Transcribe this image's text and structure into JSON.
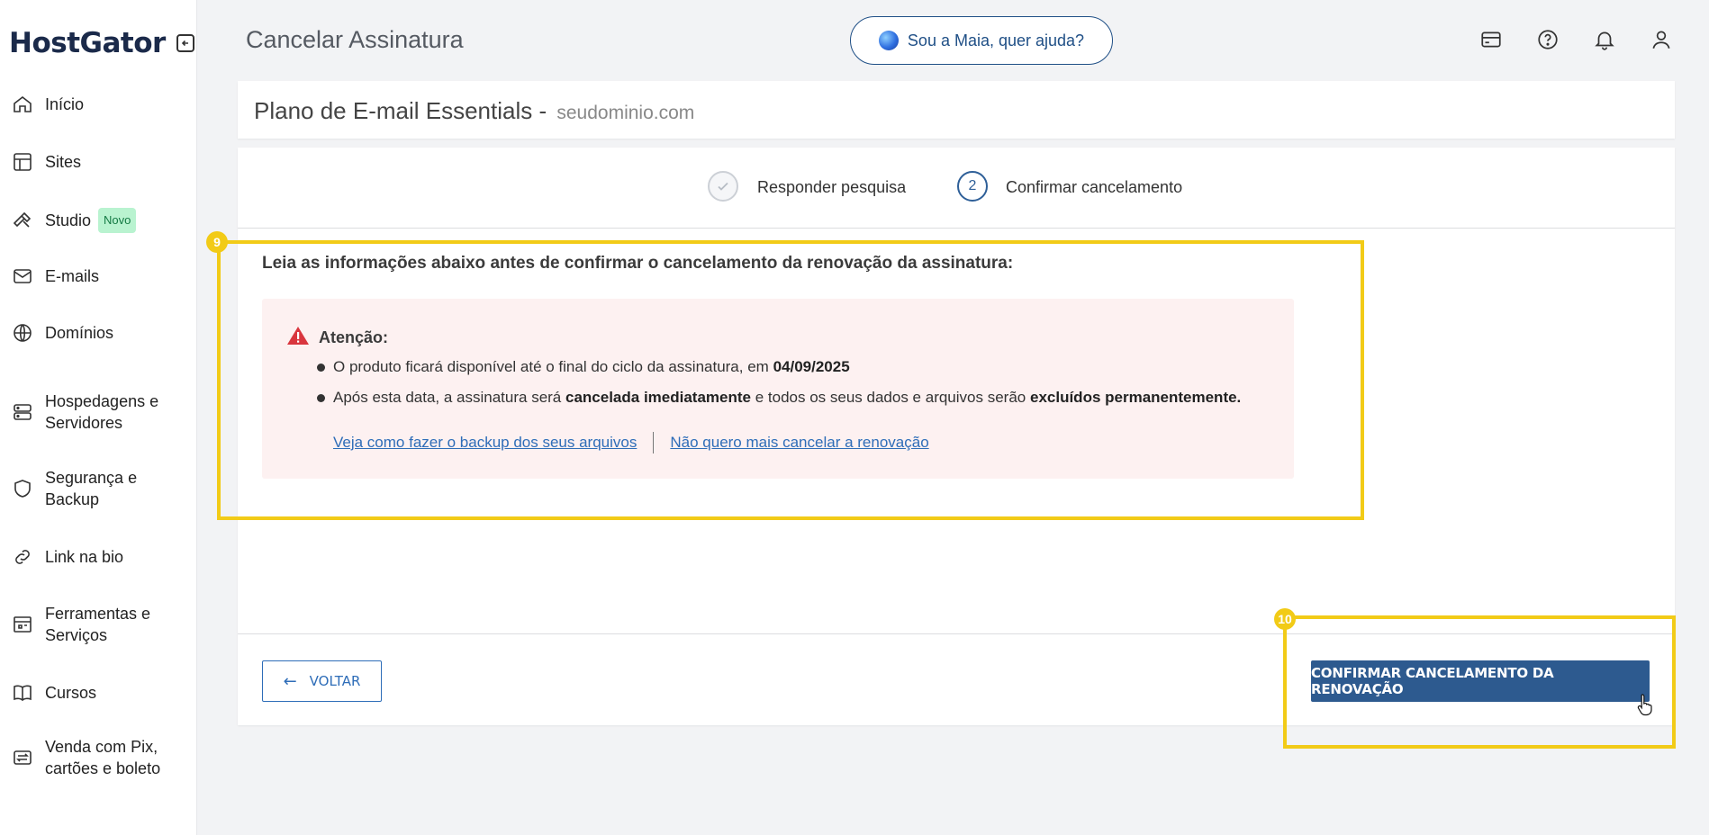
{
  "brand": {
    "logo_text": "HostGator"
  },
  "sidebar": {
    "items": [
      {
        "label": "Início",
        "icon": "home-icon"
      },
      {
        "label": "Sites",
        "icon": "layout-icon"
      },
      {
        "label": "Studio",
        "icon": "hammer-icon",
        "badge": "Novo"
      },
      {
        "label": "E-mails",
        "icon": "mail-icon"
      },
      {
        "label": "Domínios",
        "icon": "globe-icon"
      },
      {
        "label": "Hospedagens e Servidores",
        "icon": "server-icon"
      },
      {
        "label": "Segurança e Backup",
        "icon": "shield-icon"
      },
      {
        "label": "Link na bio",
        "icon": "link-icon"
      },
      {
        "label": "Ferramentas e Serviços",
        "icon": "tools-icon"
      },
      {
        "label": "Cursos",
        "icon": "book-icon"
      },
      {
        "label": "Venda com Pix, cartões e boleto",
        "icon": "transfer-icon"
      }
    ]
  },
  "header": {
    "title": "Cancelar Assinatura",
    "assistant_label": "Sou a Maia, quer ajuda?",
    "icons": [
      "credit-card-icon",
      "help-icon",
      "bell-icon",
      "user-icon"
    ]
  },
  "plan": {
    "name": "Plano de E-mail Essentials -",
    "domain": "seudominio.com"
  },
  "stepper": {
    "step1_label": "Responder pesquisa",
    "step2_number": "2",
    "step2_label": "Confirmar cancelamento"
  },
  "content": {
    "intro": "Leia as informações abaixo antes de confirmar o cancelamento da renovação da assinatura:",
    "alert_title": "Atenção:",
    "bullet1_text": "O produto ficará disponível até o final do ciclo da assinatura, em",
    "bullet1_date": "04/09/2025",
    "bullet2_part1": "Após esta data, a assinatura será",
    "bullet2_bold1": "cancelada imediatamente",
    "bullet2_part2": "e todos os seus dados e arquivos serão",
    "bullet2_bold2": "excluídos permanentemente.",
    "link_backup": "Veja como fazer o backup dos seus arquivos",
    "link_keep": "Não quero mais cancelar a renovação"
  },
  "actions": {
    "back_label": "VOLTAR",
    "confirm_label": "CONFIRMAR CANCELAMENTO DA RENOVAÇÃO"
  },
  "annotations": {
    "box9_label": "9",
    "box10_label": "10",
    "highlight_color": "#f2cb17"
  },
  "colors": {
    "primary": "#2d5a8f",
    "link": "#2e6db8",
    "alert_bg": "#fdf1f1",
    "warning_icon": "#d9363e",
    "badge_bg": "#b9f3d0"
  }
}
